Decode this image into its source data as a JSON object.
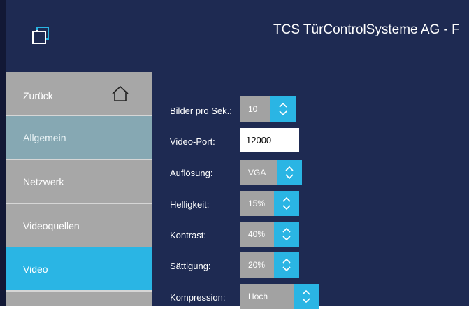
{
  "header": {
    "title": "TCS TürControlSysteme AG - F",
    "logo_icon": "window-logo-icon"
  },
  "sidebar": {
    "items": [
      {
        "label": "Zurück",
        "icon": "home-icon"
      },
      {
        "label": "Allgemein"
      },
      {
        "label": "Netzwerk"
      },
      {
        "label": "Videoquellen"
      },
      {
        "label": "Video"
      },
      {
        "label": ""
      }
    ],
    "active_index": 4
  },
  "form": {
    "fps": {
      "label": "Bilder pro Sek.:",
      "value": "10"
    },
    "port": {
      "label": "Video-Port:",
      "value": "12000"
    },
    "resolution": {
      "label": "Auflösung:",
      "value": "VGA"
    },
    "brightness": {
      "label": "Helligkeit:",
      "value": "15%"
    },
    "contrast": {
      "label": "Kontrast:",
      "value": "40%"
    },
    "saturation": {
      "label": "Sättigung:",
      "value": "20%"
    },
    "compression": {
      "label": "Kompression:",
      "value": "Hoch"
    }
  },
  "colors": {
    "header_bg": "#1e2a52",
    "accent": "#2ab5e4",
    "sidebar_item": "#a7a7a7",
    "sidebar_selected": "#86a8b3"
  }
}
